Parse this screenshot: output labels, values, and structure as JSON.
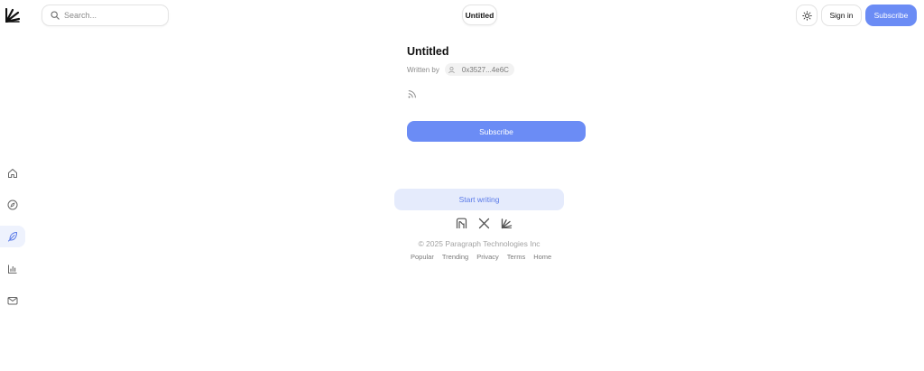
{
  "header": {
    "search_placeholder": "Search...",
    "title_pill": "Untitled",
    "signin_label": "Sign in",
    "subscribe_label": "Subscribe"
  },
  "nav": {
    "items": [
      {
        "name": "home",
        "icon": "home-icon"
      },
      {
        "name": "explore",
        "icon": "compass-icon"
      },
      {
        "name": "write",
        "icon": "feather-icon",
        "active": true
      },
      {
        "name": "analytics",
        "icon": "chart-icon"
      },
      {
        "name": "inbox",
        "icon": "mail-icon"
      }
    ]
  },
  "post": {
    "title": "Untitled",
    "written_by": "Written by",
    "author": "0x3527...4e6C",
    "subscribe_label": "Subscribe"
  },
  "cta": {
    "start_writing": "Start writing"
  },
  "footer": {
    "social_icons": [
      "paragraph-logo-icon",
      "x-icon",
      "paragraph-icon"
    ],
    "copyright": "© 2025 Paragraph Technologies Inc",
    "links": [
      "Popular",
      "Trending",
      "Privacy",
      "Terms",
      "Home"
    ]
  },
  "colors": {
    "accent": "#6b8cf5",
    "accent_light": "#e5ebfc",
    "accent_text": "#5a7ae8",
    "muted_text": "#8a8a8a"
  }
}
